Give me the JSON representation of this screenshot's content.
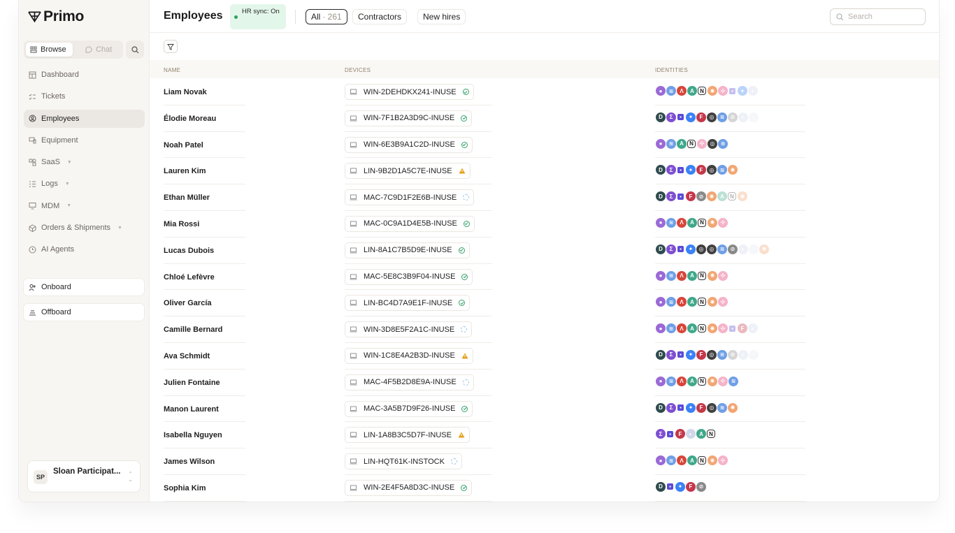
{
  "app": {
    "name": "Primo",
    "page_title": "Employees",
    "sync_badge": "HR sync: On"
  },
  "sidebar": {
    "modes": {
      "browse": "Browse",
      "chat": "Chat"
    },
    "items": [
      {
        "label": "Dashboard",
        "icon": "table-icon"
      },
      {
        "label": "Tickets",
        "icon": "checklist-icon"
      },
      {
        "label": "Employees",
        "icon": "user-circle-icon"
      },
      {
        "label": "Equipment",
        "icon": "device-icon"
      },
      {
        "label": "SaaS",
        "icon": "apps-icon"
      },
      {
        "label": "Logs",
        "icon": "list-icon"
      },
      {
        "label": "MDM",
        "icon": "monitor-icon"
      },
      {
        "label": "Orders & Shipments",
        "icon": "box-icon"
      },
      {
        "label": "AI Agents",
        "icon": "spark-icon"
      }
    ],
    "actions": {
      "onboard": "Onboard",
      "offboard": "Offboard"
    },
    "user": {
      "initials": "SP",
      "name": "Sloan Participat..."
    }
  },
  "tabs": {
    "all_label": "All",
    "all_count": "· 261",
    "contractors": "Contractors",
    "new_hires": "New hires"
  },
  "search": {
    "placeholder": "Search"
  },
  "table": {
    "columns": {
      "name": "NAME",
      "devices": "DEVICES",
      "identities": "IDENTITIES"
    },
    "rows": [
      {
        "name": "Liam Novak",
        "device": "WIN-2DEHDKX241-INUSE",
        "status": "ok",
        "ids": [
          "p",
          "i",
          "r",
          "g",
          "n",
          "o",
          "s",
          "t",
          "b",
          "x"
        ]
      },
      {
        "name": "Élodie Moreau",
        "device": "WIN-7F1B2A3D9C-INUSE",
        "status": "ok",
        "ids": [
          "k",
          "v",
          "t",
          "b",
          "f",
          "h",
          "i",
          "z",
          "x",
          "y"
        ]
      },
      {
        "name": "Noah Patel",
        "device": "WIN-6E3B9A1C2D-INUSE",
        "status": "ok",
        "ids": [
          "p",
          "i",
          "g",
          "n",
          "s",
          "h",
          "i"
        ]
      },
      {
        "name": "Lauren Kim",
        "device": "LIN-9B2D1A5C7E-INUSE",
        "status": "warn",
        "ids": [
          "k",
          "v",
          "t",
          "b",
          "f",
          "h",
          "i",
          "o"
        ]
      },
      {
        "name": "Ethan Müller",
        "device": "MAC-7C9D1F2E6B-INUSE",
        "status": "sync",
        "ids": [
          "k",
          "v",
          "t",
          "f",
          "z",
          "o",
          "g",
          "n",
          "o"
        ]
      },
      {
        "name": "Mia Rossi",
        "device": "MAC-0C9A1D4E5B-INUSE",
        "status": "ok",
        "ids": [
          "p",
          "i",
          "r",
          "g",
          "n",
          "o",
          "s"
        ]
      },
      {
        "name": "Lucas Dubois",
        "device": "LIN-8A1C7B5D9E-INUSE",
        "status": "ok",
        "ids": [
          "k",
          "v",
          "t",
          "b",
          "h",
          "h",
          "i",
          "z",
          "x",
          "y",
          "o"
        ]
      },
      {
        "name": "Chloé Lefèvre",
        "device": "MAC-5E8C3B9F04-INUSE",
        "status": "ok",
        "ids": [
          "p",
          "i",
          "r",
          "g",
          "n",
          "o",
          "s"
        ]
      },
      {
        "name": "Oliver García",
        "device": "LIN-BC4D7A9E1F-INUSE",
        "status": "ok",
        "ids": [
          "p",
          "i",
          "r",
          "g",
          "n",
          "o",
          "s"
        ]
      },
      {
        "name": "Camille Bernard",
        "device": "WIN-3D8E5F2A1C-INUSE",
        "status": "sync",
        "ids": [
          "p",
          "i",
          "r",
          "g",
          "n",
          "o",
          "s",
          "t",
          "f",
          "x"
        ]
      },
      {
        "name": "Ava Schmidt",
        "device": "WIN-1C8E4A2B3D-INUSE",
        "status": "warn",
        "ids": [
          "k",
          "v",
          "t",
          "b",
          "f",
          "h",
          "i",
          "z",
          "x",
          "y"
        ]
      },
      {
        "name": "Julien Fontaine",
        "device": "MAC-4F5B2D8E9A-INUSE",
        "status": "sync",
        "ids": [
          "p",
          "i",
          "r",
          "g",
          "n",
          "o",
          "s",
          "i"
        ]
      },
      {
        "name": "Manon Laurent",
        "device": "MAC-3A5B7D9F26-INUSE",
        "status": "ok",
        "ids": [
          "k",
          "v",
          "t",
          "b",
          "f",
          "h",
          "i",
          "o"
        ]
      },
      {
        "name": "Isabella Nguyen",
        "device": "LIN-1A8B3C5D7F-INUSE",
        "status": "warn",
        "ids": [
          "v",
          "t",
          "f",
          "x",
          "g",
          "n"
        ]
      },
      {
        "name": "James Wilson",
        "device": "LIN-HQT61K-INSTOCK",
        "status": "sync",
        "ids": [
          "p",
          "i",
          "r",
          "g",
          "n",
          "o",
          "s"
        ]
      },
      {
        "name": "Sophia Kim",
        "device": "WIN-2E4F5A8D3C-INUSE",
        "status": "ok",
        "ids": [
          "k",
          "t",
          "b",
          "f",
          "z"
        ]
      }
    ]
  },
  "colors": {
    "ok": "#36a26a",
    "warn": "#e5a11c",
    "sync": "#8fc2e8",
    "sync_badge_bg": "#e3f6ea"
  }
}
